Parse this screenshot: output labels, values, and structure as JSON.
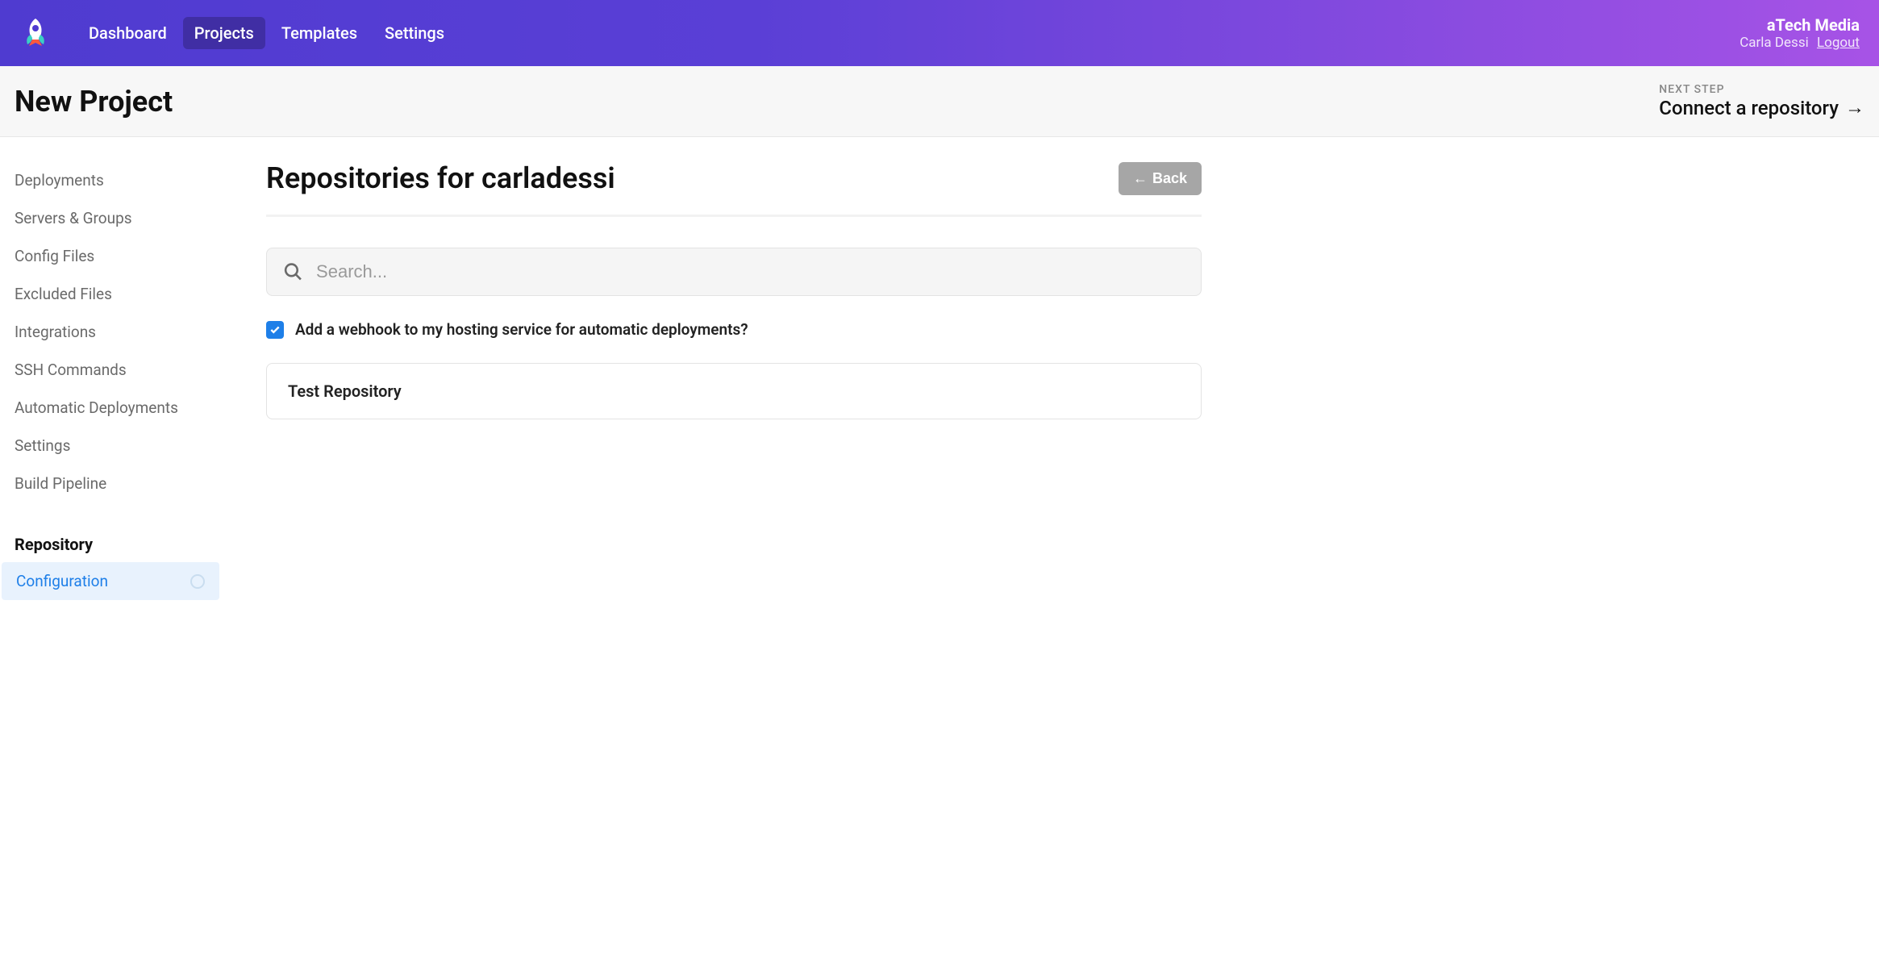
{
  "topbar": {
    "nav": {
      "dashboard": "Dashboard",
      "projects": "Projects",
      "templates": "Templates",
      "settings": "Settings"
    },
    "org": "aTech Media",
    "user": "Carla Dessi",
    "logout": "Logout"
  },
  "subheader": {
    "title": "New Project",
    "next_step_label": "NEXT STEP",
    "next_step_link": "Connect a repository"
  },
  "sidebar": {
    "items": {
      "deployments": "Deployments",
      "servers_groups": "Servers & Groups",
      "config_files": "Config Files",
      "excluded_files": "Excluded Files",
      "integrations": "Integrations",
      "ssh_commands": "SSH Commands",
      "automatic_deployments": "Automatic Deployments",
      "settings": "Settings",
      "build_pipeline": "Build Pipeline"
    },
    "heading": "Repository",
    "configuration": "Configuration"
  },
  "main": {
    "title": "Repositories for carladessi",
    "back": "Back",
    "search_placeholder": "Search...",
    "webhook_label": "Add a webhook to my hosting service for automatic deployments?",
    "repos": {
      "0": "Test Repository"
    }
  }
}
